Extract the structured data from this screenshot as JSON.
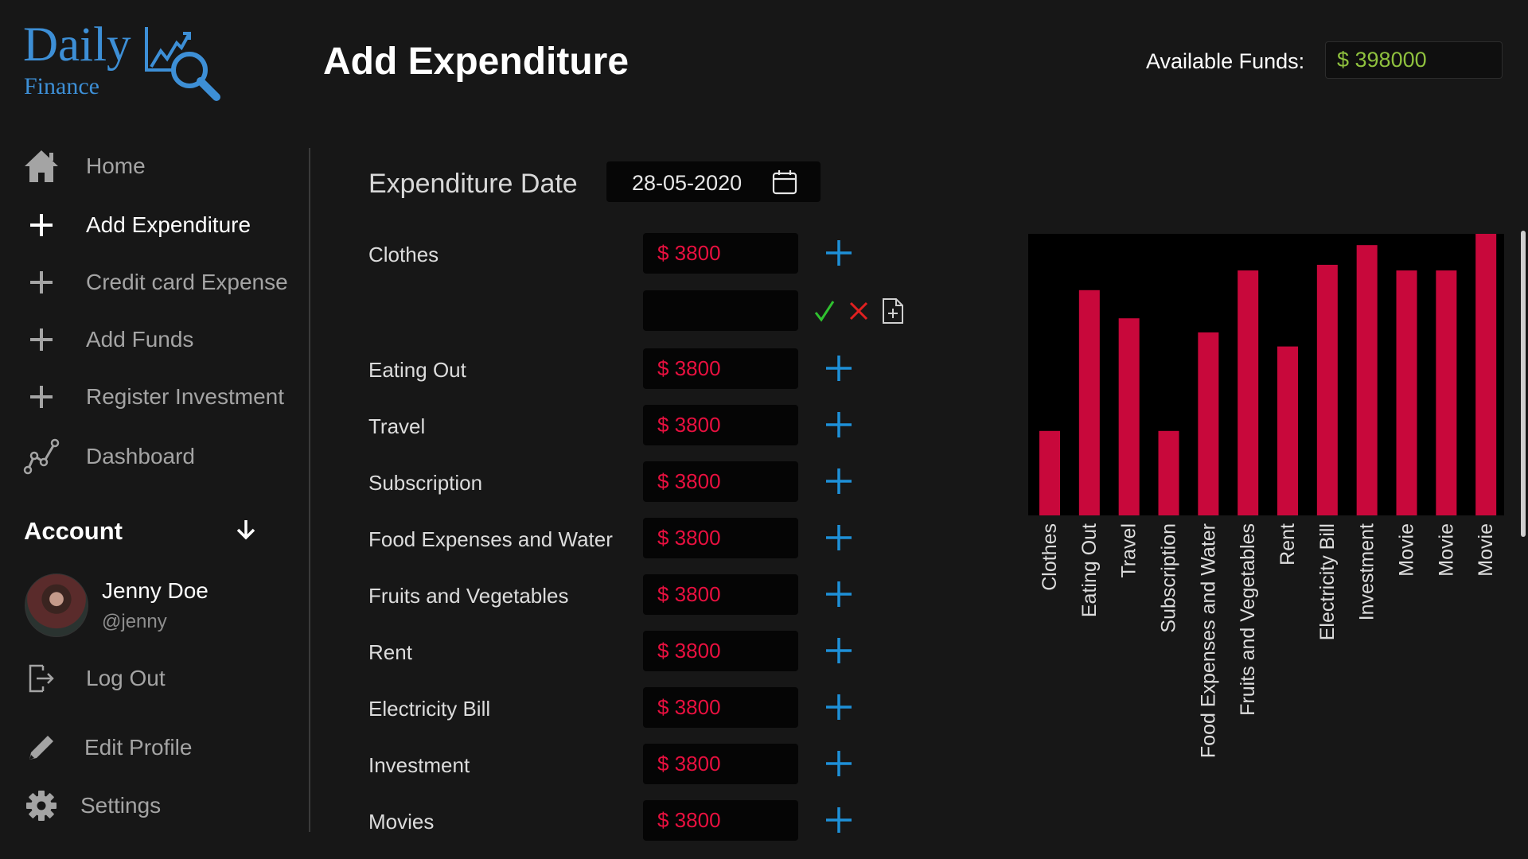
{
  "app": {
    "logo_word1": "Daily",
    "logo_word2": "Finance"
  },
  "header": {
    "title": "Add Expenditure",
    "funds_label": "Available Funds:",
    "funds_value": "$ 398000"
  },
  "sidebar": {
    "items": [
      {
        "label": "Home",
        "icon": "home-icon"
      },
      {
        "label": "Add Expenditure",
        "icon": "plus-icon"
      },
      {
        "label": "Credit card Expense",
        "icon": "plus-icon"
      },
      {
        "label": "Add Funds",
        "icon": "plus-icon"
      },
      {
        "label": "Register Investment",
        "icon": "plus-icon"
      },
      {
        "label": "Dashboard",
        "icon": "chart-line-icon"
      }
    ],
    "account_title": "Account",
    "user": {
      "name": "Jenny Doe",
      "handle": "@jenny"
    },
    "logout": "Log Out",
    "edit_profile": "Edit Profile",
    "settings": "Settings"
  },
  "form": {
    "date_label": "Expenditure Date",
    "date_value": "28-05-2020",
    "rows": [
      {
        "label": "Clothes",
        "amount": "$ 3800"
      },
      {
        "label": "Eating Out",
        "amount": "$ 3800"
      },
      {
        "label": "Travel",
        "amount": "$ 3800"
      },
      {
        "label": "Subscription",
        "amount": "$ 3800"
      },
      {
        "label": "Food Expenses and Water",
        "amount": "$ 3800"
      },
      {
        "label": "Fruits and Vegetables",
        "amount": "$ 3800"
      },
      {
        "label": "Rent",
        "amount": "$ 3800"
      },
      {
        "label": "Electricity Bill",
        "amount": "$ 3800"
      },
      {
        "label": "Investment",
        "amount": "$ 3800"
      },
      {
        "label": "Movies",
        "amount": "$ 3800"
      }
    ],
    "extra_input_value": ""
  },
  "colors": {
    "accent_blue": "#1e90d8",
    "amount_red": "#e8103f",
    "bar": "#c8083b",
    "funds_green": "#8fc13e",
    "confirm_green": "#2fc12f",
    "cancel_red": "#e02020"
  },
  "chart_data": {
    "type": "bar",
    "categories": [
      "Clothes",
      "Eating Out",
      "Travel",
      "Subscription",
      "Food Expenses and Water",
      "Fruits and Vegetables",
      "Rent",
      "Electricity Bill",
      "Investment",
      "Movie",
      "Movie",
      "Movie"
    ],
    "values": [
      30,
      80,
      70,
      30,
      65,
      87,
      60,
      89,
      96,
      87,
      87,
      100
    ],
    "ylim": [
      0,
      100
    ],
    "grid": false,
    "legend": "none"
  }
}
